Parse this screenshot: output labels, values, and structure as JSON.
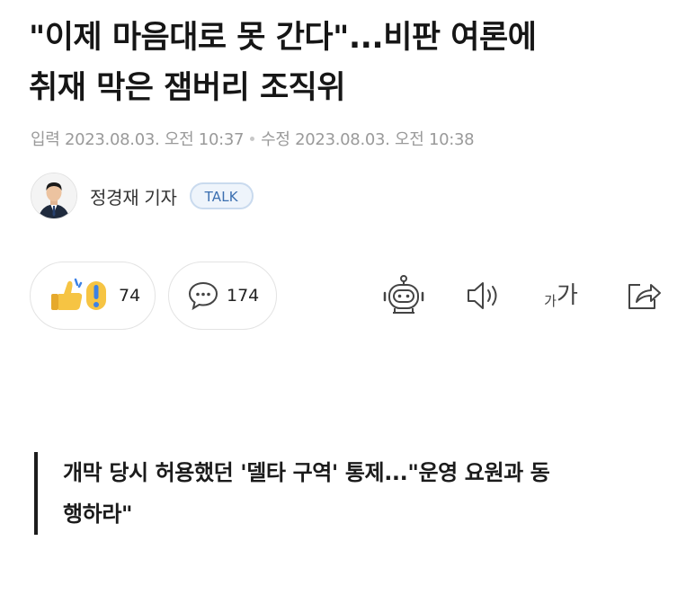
{
  "article": {
    "title_line1": "\"이제 마음대로 못 간다\"...비판 여론에",
    "title_line2": "취재 막은 잼버리 조직위",
    "published": "입력 2023.08.03. 오전 10:37",
    "modified": "수정 2023.08.03. 오전 10:38",
    "reporter": "정경재 기자",
    "talk_label": "TALK"
  },
  "reactions": {
    "like_count": "74",
    "comment_count": "174"
  },
  "tools": {
    "font_size_label_small": "가",
    "font_size_label_large": "가"
  },
  "subheading": {
    "line1": "개막 당시 허용했던 '델타 구역' 통제...\"운영 요원과 동",
    "line2": "행하라\""
  },
  "colors": {
    "talk_border": "#c9daee",
    "talk_text": "#3b6fb0",
    "emoji_yellow": "#f6c443",
    "emoji_blue": "#3d82e6"
  }
}
